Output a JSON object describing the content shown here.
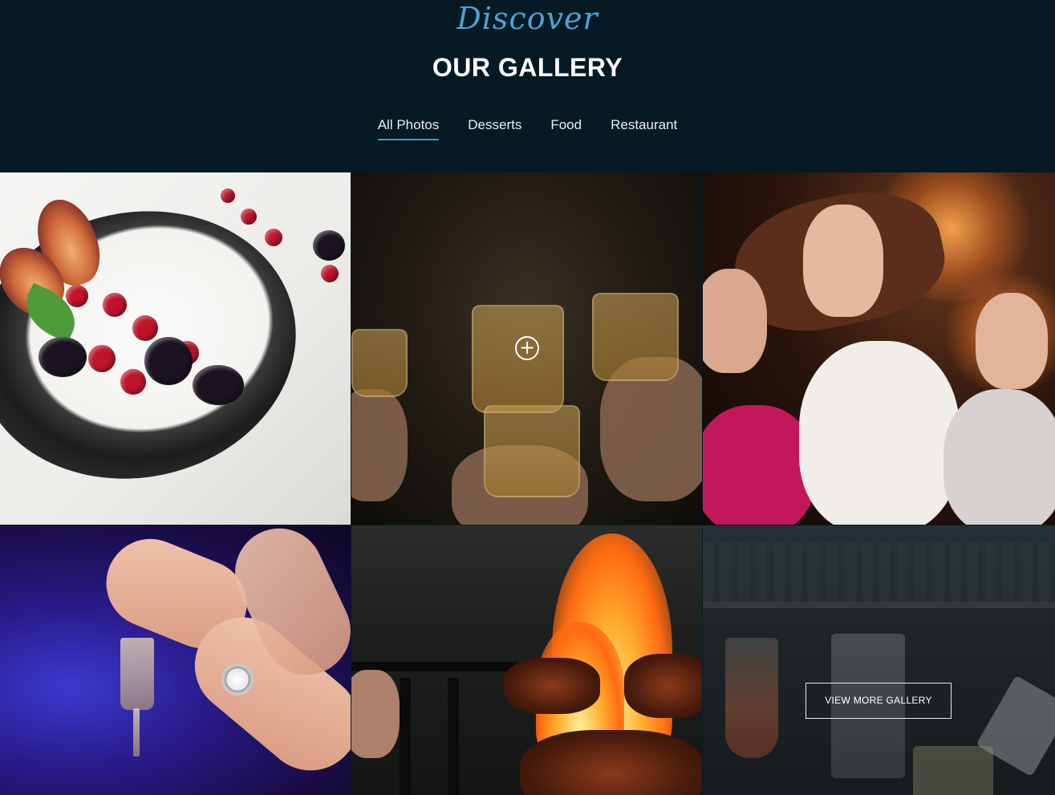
{
  "header": {
    "script_title": "Discover",
    "title": "OUR GALLERY",
    "tabs": [
      {
        "label": "All Photos",
        "active": true
      },
      {
        "label": "Desserts",
        "active": false
      },
      {
        "label": "Food",
        "active": false
      },
      {
        "label": "Restaurant",
        "active": false
      }
    ]
  },
  "gallery": {
    "hover_icon": "plus-circle-icon",
    "view_more_label": "VIEW MORE GALLERY"
  },
  "colors": {
    "background": "#051a24",
    "accent": "#3f9ad6",
    "script_title": "#4aa3d6"
  }
}
